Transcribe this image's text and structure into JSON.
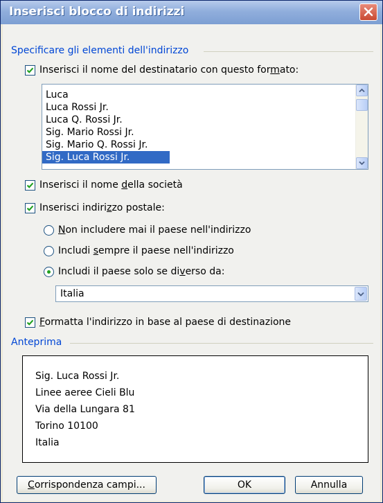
{
  "dialog": {
    "title": "Inserisci blocco di indirizzi"
  },
  "address_elements": {
    "group_label": "Specificare gli elementi dell'indirizzo",
    "insert_recipient": {
      "pre": "Inserisci il nome del destinatario con questo for",
      "ul": "m",
      "post": "ato:",
      "checked": true
    },
    "name_formats": [
      "Luca",
      "Luca Rossi Jr.",
      "Luca Q. Rossi Jr.",
      "Sig. Mario Rossi Jr.",
      "Sig. Mario Q. Rossi Jr.",
      "Sig. Luca Rossi Jr."
    ],
    "selected_format": "Sig. Luca Rossi Jr.",
    "insert_company": {
      "pre": "Inserisci il nome ",
      "ul": "d",
      "post": "ella società",
      "checked": true
    },
    "insert_postal": {
      "pre": "Inserisci indiri",
      "ul": "z",
      "post": "zo postale:",
      "checked": true
    },
    "country_options": [
      {
        "pre": "",
        "ul": "N",
        "post": "on includere mai il paese nell'indirizzo",
        "selected": false
      },
      {
        "pre": "Includi ",
        "ul": "s",
        "post": "empre il paese nell'indirizzo",
        "selected": false
      },
      {
        "pre": "Includi il paese solo se di",
        "ul": "v",
        "post": "erso da:",
        "selected": true
      }
    ],
    "country_value": "Italia",
    "format_by_country": {
      "pre": "",
      "ul": "F",
      "post": "ormatta l'indirizzo in base al paese di destinazione",
      "checked": true
    }
  },
  "preview": {
    "group_label": "Anteprima",
    "lines": [
      "Sig. Luca Rossi Jr.",
      "Linee aeree Cieli Blu",
      "Via della Lungara 81",
      "Torino 10100",
      "Italia"
    ]
  },
  "buttons": {
    "match_fields": {
      "pre": "",
      "ul": "C",
      "post": "orrispondenza campi..."
    },
    "ok": "OK",
    "cancel": "Annulla"
  },
  "colors": {
    "title_bar": "#90aedc",
    "group_label": "#0046d5",
    "selection": "#316ac5",
    "check_mark": "#21a121"
  }
}
